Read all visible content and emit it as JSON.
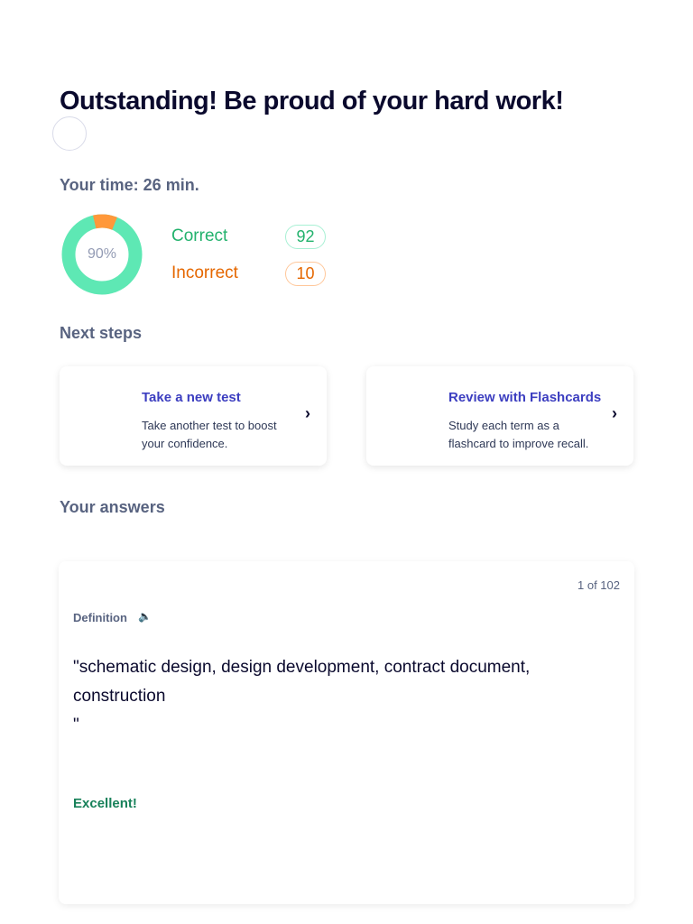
{
  "title": "Outstanding! Be proud of your hard work!",
  "time": "Your time: 26 min.",
  "result": {
    "percent_label": "90%",
    "percent": 90,
    "correct_label": "Correct",
    "correct": "92",
    "incorrect_label": "Incorrect",
    "incorrect": "10"
  },
  "colors": {
    "correct": "#23b26d",
    "incorrect": "#e56700",
    "ring_correct": "#5ee8b4",
    "ring_incorrect": "#ff983a"
  },
  "next_steps": {
    "heading": "Next steps",
    "cards": [
      {
        "title": "Take a new test",
        "desc": "Take another test to boost your confidence."
      },
      {
        "title": "Review with Flashcards",
        "desc": "Study each term as a flashcard to improve recall."
      }
    ]
  },
  "answers": {
    "heading": "Your answers",
    "counter": "1 of 102",
    "term_label": "Definition",
    "question": "\"schematic design, design development, contract document, construction\n\"",
    "feedback": "Excellent!"
  }
}
